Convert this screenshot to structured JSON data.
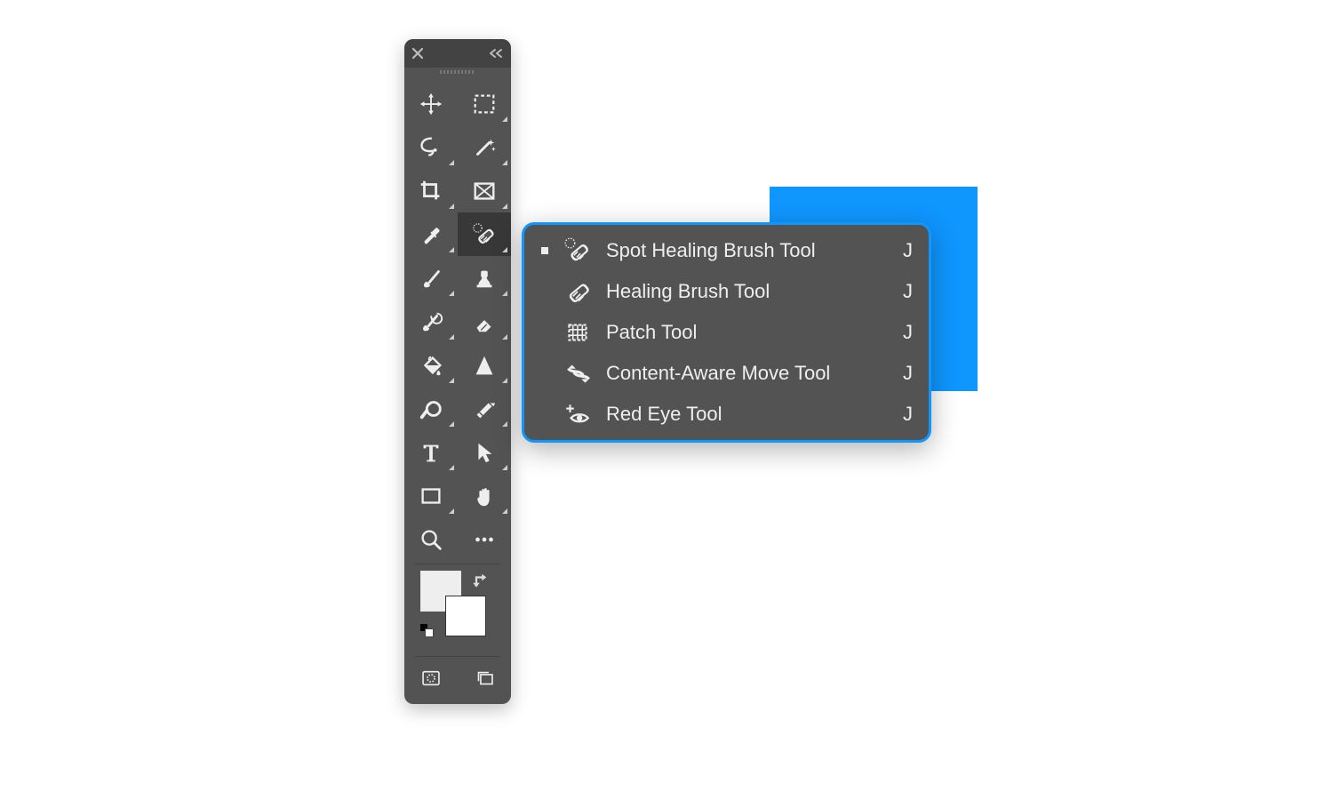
{
  "tools": [
    {
      "name": "move-tool",
      "icon": "move",
      "flyout": false
    },
    {
      "name": "marquee-tool",
      "icon": "marquee",
      "flyout": true
    },
    {
      "name": "lasso-tool",
      "icon": "lasso",
      "flyout": true
    },
    {
      "name": "magic-wand-tool",
      "icon": "wand",
      "flyout": true
    },
    {
      "name": "crop-tool",
      "icon": "crop",
      "flyout": true
    },
    {
      "name": "frame-tool",
      "icon": "frame",
      "flyout": true
    },
    {
      "name": "eyedropper-tool",
      "icon": "eyedropper",
      "flyout": true
    },
    {
      "name": "spot-healing-brush-tool",
      "icon": "spotheal",
      "flyout": true,
      "selected": true
    },
    {
      "name": "brush-tool",
      "icon": "brush",
      "flyout": true
    },
    {
      "name": "clone-stamp-tool",
      "icon": "stamp",
      "flyout": true
    },
    {
      "name": "history-brush-tool",
      "icon": "histbrush",
      "flyout": true
    },
    {
      "name": "eraser-tool",
      "icon": "eraser",
      "flyout": true
    },
    {
      "name": "gradient-tool",
      "icon": "bucket",
      "flyout": true
    },
    {
      "name": "blur-tool",
      "icon": "triangle",
      "flyout": true
    },
    {
      "name": "dodge-tool",
      "icon": "dodge",
      "flyout": true
    },
    {
      "name": "pen-tool",
      "icon": "pen",
      "flyout": true
    },
    {
      "name": "type-tool",
      "icon": "type",
      "flyout": true
    },
    {
      "name": "path-selection-tool",
      "icon": "arrow",
      "flyout": true
    },
    {
      "name": "rectangle-tool",
      "icon": "rect",
      "flyout": true
    },
    {
      "name": "hand-tool",
      "icon": "hand",
      "flyout": true
    },
    {
      "name": "zoom-tool",
      "icon": "zoom",
      "flyout": false
    },
    {
      "name": "more-tools",
      "icon": "more",
      "flyout": false
    }
  ],
  "colors": {
    "foreground": "#eeeeee",
    "background": "#ffffff"
  },
  "bottom": [
    {
      "name": "quick-mask-toggle",
      "icon": "quickmask"
    },
    {
      "name": "screen-mode-toggle",
      "icon": "screenmode"
    }
  ],
  "flyout": {
    "items": [
      {
        "active": true,
        "icon": "spotheal",
        "label": "Spot Healing Brush Tool",
        "key": "J",
        "name": "flyout-spot-healing-brush"
      },
      {
        "active": false,
        "icon": "heal",
        "label": "Healing Brush Tool",
        "key": "J",
        "name": "flyout-healing-brush"
      },
      {
        "active": false,
        "icon": "patch",
        "label": "Patch Tool",
        "key": "J",
        "name": "flyout-patch"
      },
      {
        "active": false,
        "icon": "contentmove",
        "label": "Content-Aware Move Tool",
        "key": "J",
        "name": "flyout-content-aware-move"
      },
      {
        "active": false,
        "icon": "redeye",
        "label": "Red Eye Tool",
        "key": "J",
        "name": "flyout-red-eye"
      }
    ]
  }
}
